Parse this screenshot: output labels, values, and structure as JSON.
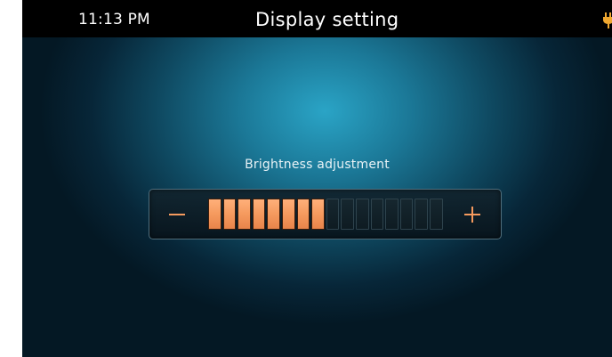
{
  "status_bar": {
    "time": "11:13 PM",
    "title": "Display setting",
    "corner_icon": "plug-icon"
  },
  "brightness": {
    "label": "Brightness adjustment",
    "level": 8,
    "max_level": 16,
    "decrease_symbol": "minus-icon",
    "increase_symbol": "plus-icon"
  },
  "colors": {
    "accent": "#f59a5e",
    "segment_off": "#13242c",
    "background_glow": "#2aa4c6",
    "corner_icon": "#f0a830"
  }
}
